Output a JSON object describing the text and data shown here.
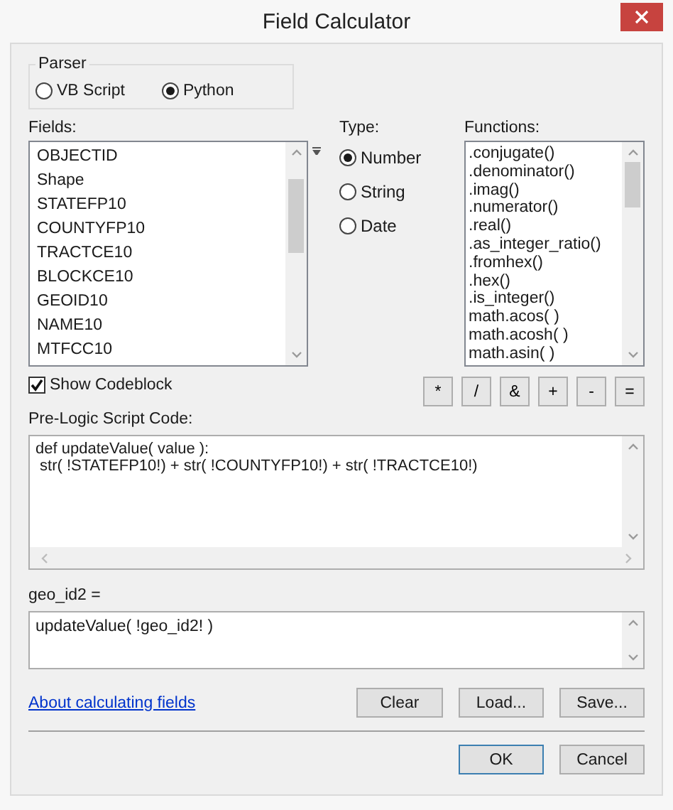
{
  "window": {
    "title": "Field Calculator"
  },
  "parser": {
    "label": "Parser",
    "options": [
      {
        "label": "VB Script",
        "selected": false
      },
      {
        "label": "Python",
        "selected": true
      }
    ]
  },
  "fields": {
    "label": "Fields:",
    "items": [
      "OBJECTID",
      "Shape",
      "STATEFP10",
      "COUNTYFP10",
      "TRACTCE10",
      "BLOCKCE10",
      "GEOID10",
      "NAME10",
      "MTFCC10"
    ]
  },
  "type": {
    "label": "Type:",
    "options": [
      {
        "label": "Number",
        "selected": true
      },
      {
        "label": "String",
        "selected": false
      },
      {
        "label": "Date",
        "selected": false
      }
    ]
  },
  "functions": {
    "label": "Functions:",
    "items": [
      ".conjugate()",
      ".denominator()",
      ".imag()",
      ".numerator()",
      ".real()",
      ".as_integer_ratio()",
      ".fromhex()",
      ".hex()",
      ".is_integer()",
      "math.acos( )",
      "math.acosh( )",
      "math.asin( )"
    ]
  },
  "show_codeblock": {
    "label": "Show Codeblock",
    "checked": true
  },
  "operators": [
    "*",
    "/",
    "&",
    "+",
    "-",
    "="
  ],
  "pre_logic": {
    "label": "Pre-Logic Script Code:",
    "lines": [
      "def updateValue( value ):",
      " str( !STATEFP10!) + str( !COUNTYFP10!) + str( !TRACTCE10!)"
    ]
  },
  "expression": {
    "label": "geo_id2 =",
    "value": "updateValue( !geo_id2! )"
  },
  "help_link": "About calculating fields",
  "buttons": [
    "Clear",
    "Load...",
    "Save..."
  ],
  "dialog_buttons": [
    {
      "label": "OK",
      "default": true
    },
    {
      "label": "Cancel",
      "default": false
    }
  ]
}
